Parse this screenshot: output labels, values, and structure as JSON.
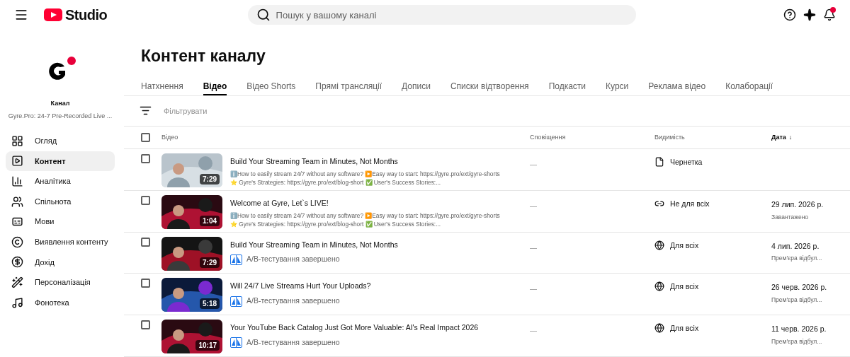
{
  "header": {
    "logo_text": "Studio",
    "search": {
      "placeholder": "Пошук у вашому каналі"
    },
    "notifications_unread": true
  },
  "channel": {
    "label": "Канал",
    "name": "Gyre.Pro: 24-7 Pre-Recorded Live ..."
  },
  "sidebar": {
    "items": [
      {
        "label": "Огляд",
        "selected": false
      },
      {
        "label": "Контент",
        "selected": true
      },
      {
        "label": "Аналітика",
        "selected": false
      },
      {
        "label": "Спільнота",
        "selected": false
      },
      {
        "label": "Мови",
        "selected": false
      },
      {
        "label": "Виявлення контенту",
        "selected": false
      },
      {
        "label": "Дохід",
        "selected": false
      },
      {
        "label": "Персоналізація",
        "selected": false
      },
      {
        "label": "Фонотека",
        "selected": false
      }
    ]
  },
  "page_title": "Контент каналу",
  "tabs": [
    {
      "label": "Натхнення",
      "selected": false
    },
    {
      "label": "Відео",
      "selected": true
    },
    {
      "label": "Відео Shorts",
      "selected": false
    },
    {
      "label": "Прямі трансляції",
      "selected": false
    },
    {
      "label": "Дописи",
      "selected": false
    },
    {
      "label": "Списки відтворення",
      "selected": false
    },
    {
      "label": "Подкасти",
      "selected": false
    },
    {
      "label": "Курси",
      "selected": false
    },
    {
      "label": "Реклама відео",
      "selected": false
    },
    {
      "label": "Колаборації",
      "selected": false
    }
  ],
  "filter": {
    "placeholder": "Фільтрувати"
  },
  "table": {
    "select_all_checked": false,
    "columns": [
      "Відео",
      "Сповіщення",
      "Видимість",
      "Дата"
    ],
    "sort_arrow": "↓",
    "rows": [
      {
        "checked": false,
        "duration": "7:29",
        "title": "Build Your Streaming Team in Minutes, Not Months",
        "kind": "description",
        "lines": [
          "ℹ️How to easily stream 24/7 without any software? ▶️Easy way to start: https://gyre.pro/ext/gyre-shorts",
          "⭐ Gyre's Strategies: https://gyre.pro/ext/blog-short ✅ User's Success Stories:..."
        ],
        "notifications": "—",
        "visibility": {
          "kind": "draft",
          "label": "Чернетка"
        }
      },
      {
        "checked": false,
        "duration": "1:04",
        "title": "Welcome at Gyre, Let`s LIVE!",
        "kind": "description",
        "lines": [
          "ℹ️How to easily stream 24/7 without any software? ▶️Easy way to start: https://gyre.pro/ext/gyre-shorts",
          "⭐ Gyre's Strategies: https://gyre.pro/ext/blog-short ✅ User's Success Stories:..."
        ],
        "notifications": "—",
        "visibility": {
          "kind": "unlisted",
          "label": "Не для всіх"
        },
        "date": "29 лип. 2026 р.",
        "date_note": "Завантажено"
      },
      {
        "checked": false,
        "duration": "7:29",
        "title": "Build Your Streaming Team in Minutes, Not Months",
        "kind": "ab_test",
        "status": "A/B-тестування завершено",
        "notifications": "—",
        "visibility": {
          "kind": "public",
          "label": "Для всіх"
        },
        "date": "4 лип. 2026 р.",
        "date_note": "Прем'єра відбул..."
      },
      {
        "checked": false,
        "duration": "5:18",
        "title": "Will 24/7 Live Streams Hurt Your Uploads?",
        "kind": "ab_test",
        "status": "A/B-тестування завершено",
        "notifications": "—",
        "visibility": {
          "kind": "public",
          "label": "Для всіх"
        },
        "date": "26 черв. 2026 р.",
        "date_note": "Прем'єра відбул..."
      },
      {
        "checked": false,
        "duration": "10:17",
        "title": "Your YouTube Back Catalog Just Got More Valuable: AI's Real Impact 2026",
        "kind": "ab_test",
        "status": "A/B-тестування завершено",
        "notifications": "—",
        "visibility": {
          "kind": "public",
          "label": "Для всіх"
        },
        "date": "11 черв. 2026 р.",
        "date_note": "Прем'єра відбул..."
      }
    ]
  }
}
